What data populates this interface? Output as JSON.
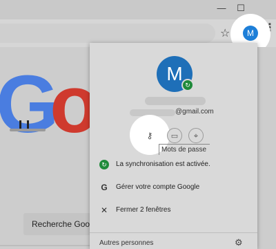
{
  "window": {
    "minimize_icon": "minimize-icon",
    "maximize_icon": "maximize-icon",
    "minimize_glyph": "—",
    "maximize_glyph": "☐"
  },
  "toolbar": {
    "star_glyph": "☆",
    "menu_glyph": "⋮",
    "avatar_letter": "M"
  },
  "page": {
    "search_button_label": "Recherche Goog"
  },
  "profile_menu": {
    "avatar_letter": "M",
    "email": "@gmail.com",
    "tooltip": "Mots de passe",
    "sync_glyph": "↻",
    "key_glyph": "⚷",
    "card_glyph": "▭",
    "location_glyph": "⌖",
    "items": [
      {
        "icon": "sync-icon",
        "glyph": "↻",
        "label": "La synchronisation est activée."
      },
      {
        "icon": "google-icon",
        "glyph": "G",
        "label": "Gérer votre compte Google"
      },
      {
        "icon": "close-icon",
        "glyph": "✕",
        "label": "Fermer 2 fenêtres"
      }
    ],
    "others_label": "Autres personnes",
    "gear_glyph": "⚙"
  },
  "colors": {
    "avatar_blue": "#1e6fb8",
    "sync_green": "#1f8a3a",
    "google_blue": "#4a7de0",
    "google_red": "#cf3a2e"
  }
}
